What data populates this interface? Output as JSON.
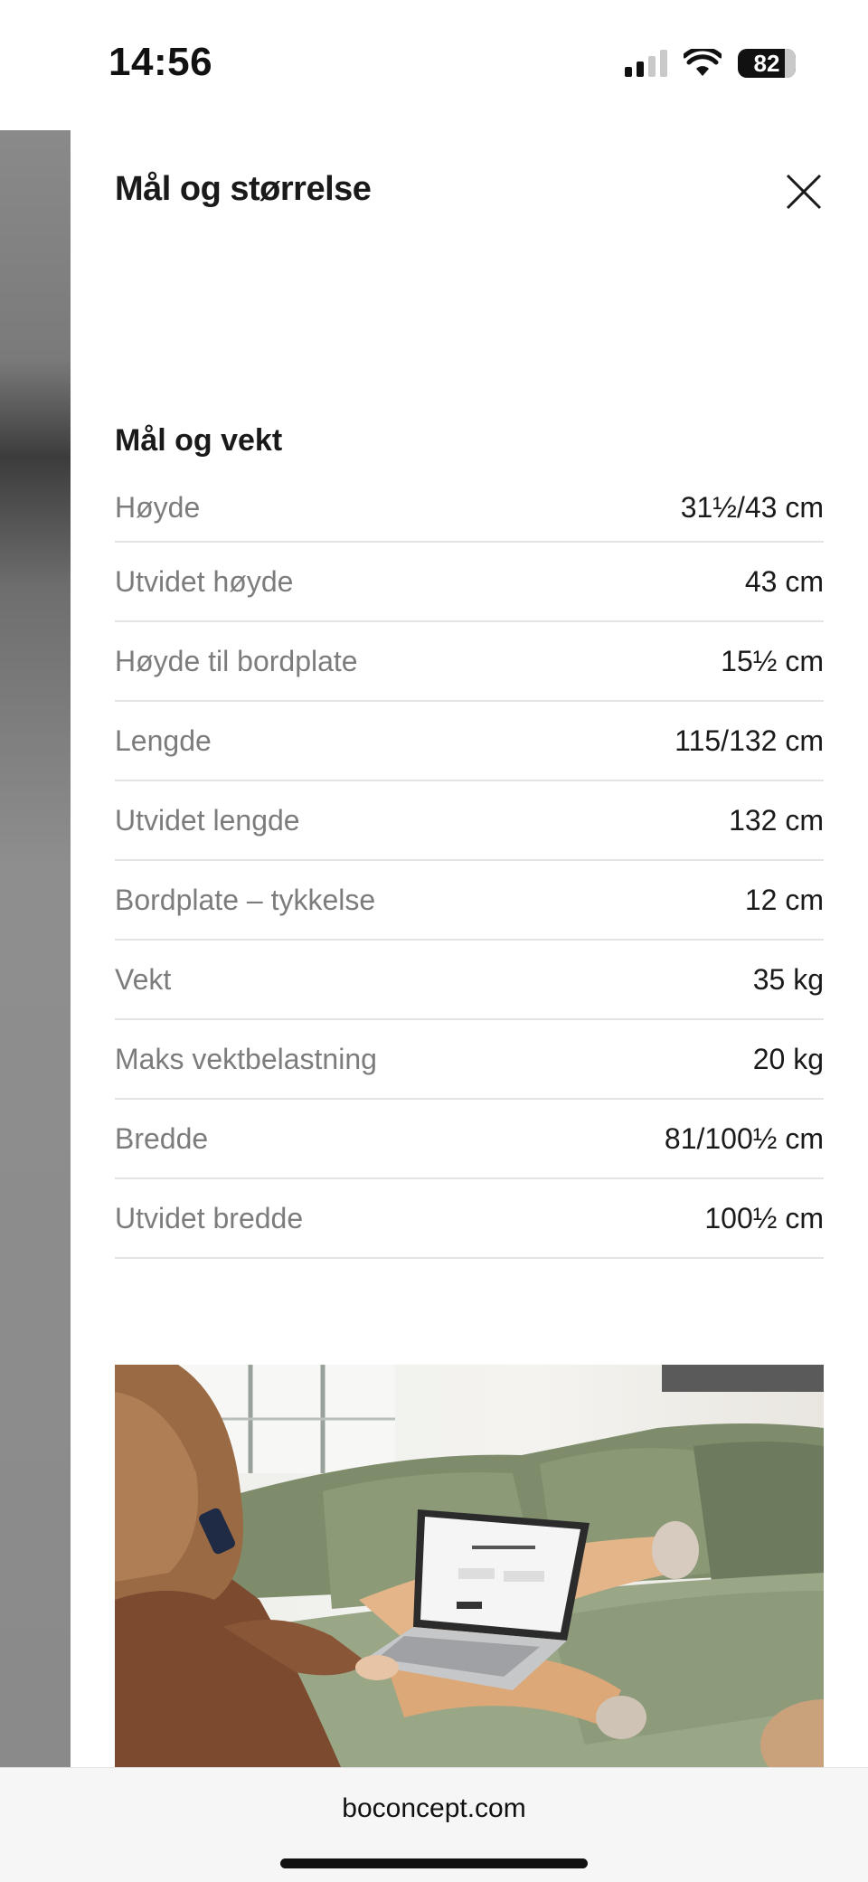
{
  "status_bar": {
    "time": "14:56",
    "battery": "82",
    "icons": [
      "signal-icon",
      "wifi-icon",
      "battery-icon"
    ]
  },
  "panel": {
    "title": "Mål og størrelse",
    "close_icon": "close-icon",
    "section_heading": "Mål og vekt",
    "specs": [
      {
        "label": "Høyde",
        "value": "31½/43 cm"
      },
      {
        "label": "Utvidet høyde",
        "value": "43 cm"
      },
      {
        "label": "Høyde til bordplate",
        "value": "15½ cm"
      },
      {
        "label": "Lengde",
        "value": "115/132 cm"
      },
      {
        "label": "Utvidet lengde",
        "value": "132 cm"
      },
      {
        "label": "Bordplate – tykkelse",
        "value": "12 cm"
      },
      {
        "label": "Vekt",
        "value": "35 kg"
      },
      {
        "label": "Maks vektbelastning",
        "value": "20 kg"
      },
      {
        "label": "Bredde",
        "value": "81/100½ cm"
      },
      {
        "label": "Utvidet bredde",
        "value": "100½ cm"
      }
    ]
  },
  "browser": {
    "url": "boconcept.com"
  },
  "colors": {
    "text": "#1a1a1a",
    "label": "#7c7c7c",
    "divider": "#e4e4e4",
    "sofa": "#8c9a78"
  }
}
